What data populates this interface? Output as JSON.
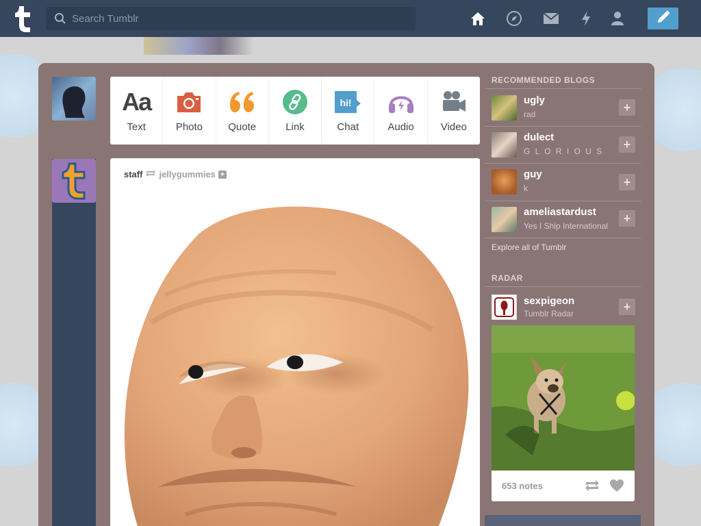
{
  "topbar": {
    "search_placeholder": "Search Tumblr",
    "nav_icons": [
      "home-icon",
      "explore-icon",
      "inbox-icon",
      "activity-icon",
      "account-icon"
    ],
    "compose_icon": "pencil-icon"
  },
  "post_types": [
    {
      "label": "Text",
      "icon": "text-icon",
      "color": "#444444"
    },
    {
      "label": "Photo",
      "icon": "photo-icon",
      "color": "#d95e40"
    },
    {
      "label": "Quote",
      "icon": "quote-icon",
      "color": "#f2992e"
    },
    {
      "label": "Link",
      "icon": "link-icon",
      "color": "#56bc8a"
    },
    {
      "label": "Chat",
      "icon": "chat-icon",
      "color": "#529ecc"
    },
    {
      "label": "Audio",
      "icon": "audio-icon",
      "color": "#a77dc2"
    },
    {
      "label": "Video",
      "icon": "video-icon",
      "color": "#748089"
    }
  ],
  "post": {
    "author": "staff",
    "source": "jellygummies"
  },
  "sidebar": {
    "recommended_title": "RECOMMENDED BLOGS",
    "blogs": [
      {
        "name": "ugly",
        "desc": "rad"
      },
      {
        "name": "dulect",
        "desc": "G L O R I O U S"
      },
      {
        "name": "guy",
        "desc": "k"
      },
      {
        "name": "ameliastardust",
        "desc": "Yes I Ship International"
      }
    ],
    "explore_label": "Explore all of Tumblr",
    "radar_title": "RADAR",
    "radar": {
      "name": "sexpigeon",
      "desc": "Tumblr Radar",
      "notes": "653 notes"
    }
  },
  "colors": {
    "nav_bg": "#36465d",
    "compose_bg": "#529ecc",
    "dashboard_bg": "#8a7575"
  }
}
